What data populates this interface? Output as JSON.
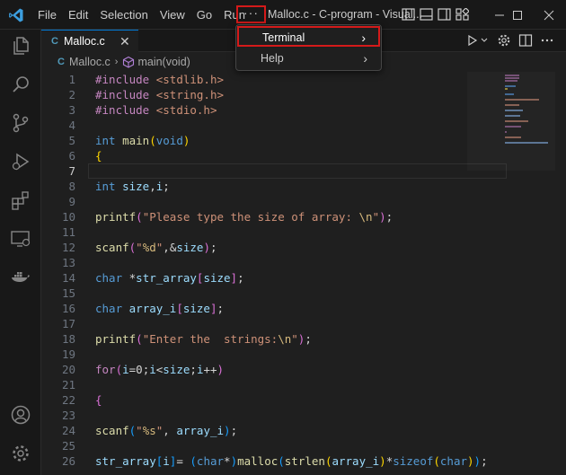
{
  "titlebar": {
    "menu": [
      "File",
      "Edit",
      "Selection",
      "View",
      "Go",
      "Run"
    ],
    "more_label": "···",
    "title": "Malloc.c - C-program - Visual..."
  },
  "dropdown": {
    "items": [
      {
        "label": "Terminal",
        "arrow": "›"
      },
      {
        "label": "Help",
        "arrow": "›"
      }
    ]
  },
  "tab": {
    "lang": "C",
    "name": "Malloc.c",
    "close": "✕"
  },
  "breadcrumb": {
    "lang": "C",
    "file": "Malloc.c",
    "sep": "›",
    "symbol": "main(void)"
  },
  "editor": {
    "active_line": 7,
    "line_numbers": [
      "1",
      "2",
      "3",
      "4",
      "5",
      "6",
      "7",
      "8",
      "9",
      "10",
      "11",
      "12",
      "13",
      "14",
      "15",
      "16",
      "17",
      "18",
      "19",
      "20",
      "21",
      "22",
      "23",
      "24",
      "25",
      "26"
    ]
  },
  "colors": {
    "accent": "#0078d4",
    "highlight_box": "#d41a1a",
    "background": "#1f1f1f"
  },
  "icons": [
    "vscode-logo",
    "explorer-icon",
    "search-icon",
    "source-control-icon",
    "run-debug-icon",
    "extensions-icon",
    "remote-explorer-icon",
    "docker-icon",
    "account-icon",
    "settings-gear-icon",
    "run-icon",
    "chevron-down-icon",
    "settings-icon",
    "split-editor-icon",
    "more-actions-icon",
    "cube-icon"
  ]
}
